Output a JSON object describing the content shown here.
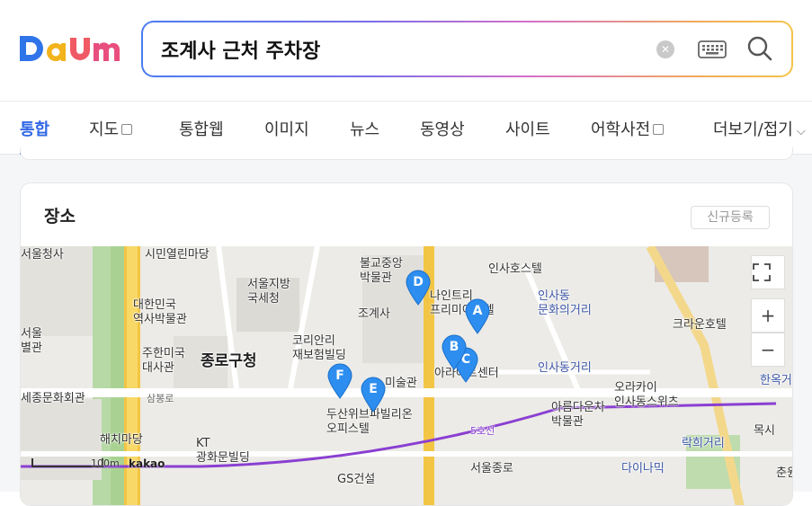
{
  "header": {
    "logo_text": "Daum",
    "search": {
      "value": "조계사 근처 주차장",
      "clear_icon": "clear-icon",
      "keyboard_icon": "keyboard-icon",
      "search_icon": "search-icon"
    }
  },
  "tabs": [
    {
      "label": "통합",
      "active": true
    },
    {
      "label": "지도",
      "has_box": true
    },
    {
      "label": "통합웹"
    },
    {
      "label": "이미지"
    },
    {
      "label": "뉴스"
    },
    {
      "label": "동영상"
    },
    {
      "label": "사이트"
    },
    {
      "label": "어학사전",
      "has_box": true
    },
    {
      "label": "더보기/접기",
      "chevron": "chevron-down-icon"
    }
  ],
  "place_card": {
    "title": "장소",
    "register_label": "신규등록",
    "map": {
      "markers": [
        "A",
        "B",
        "C",
        "D",
        "E",
        "F"
      ],
      "labels": {
        "seoul_hall": "서울청사",
        "civic_madang": "시민열린마당",
        "bulgyo_museum": "불교중앙\n박물관",
        "insa_hostel": "인사호스텔",
        "daehan_museum": "대한민국\n역사박물관",
        "seoul_police": "서울지방\n국세청",
        "nine_tree": "나인트리\n프리미어호텔",
        "insadong_center": "인사동\n문화의거리",
        "seoul_byeolgwan": "서울\n별관",
        "jogyesa": "조계사",
        "craun_hotel": "크라운호텔",
        "us_embassy": "주한미국\n대사관",
        "jongno_office": "종로구청",
        "korean_building": "코리안리\n재보험빌딩",
        "artcenter": "아라아트센터",
        "insadong_street": "인사동거리",
        "hanok_street": "한옥거",
        "sejong_center": "세종문화회관",
        "samsungro": "삼봉로",
        "art_museum": "미술관",
        "orakai": "오라카이\n인사동스위츠",
        "doosan": "두산위브파빌리온\n오피스텔",
        "areumdaun": "아름다운차\n박물관",
        "haechi": "해치마당",
        "kt_building": "KT\n광화문빌딩",
        "line5": "5호선",
        "rakhui": "락희거리",
        "moksi": "목시",
        "jongno_seoul": "서울종로",
        "gs": "GS건설",
        "dainamic": "다이나믹",
        "chunwon": "춘원"
      },
      "controls": {
        "fullscreen_icon": "fullscreen-icon",
        "zoom_in": "+",
        "zoom_out": "−"
      },
      "scale": "100m",
      "provider": "kakao"
    }
  },
  "colors": {
    "accent": "#3168e6",
    "marker": "#2d8ef0",
    "subway_line5": "#8a3fd1",
    "road_yellow": "#f3c545"
  }
}
